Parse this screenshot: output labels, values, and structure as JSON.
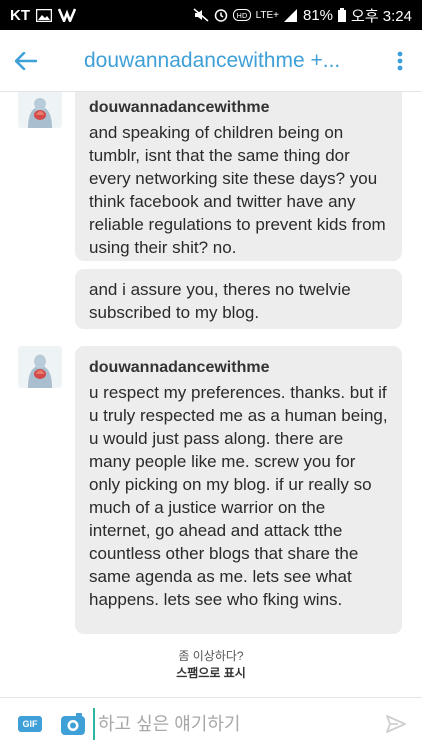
{
  "status_bar": {
    "carrier": "KT",
    "network": "LTE+",
    "battery": "81%",
    "time": "오후 3:24"
  },
  "header": {
    "title": "douwannadancewithme +..."
  },
  "messages": [
    {
      "author": "douwannadancewithme",
      "text": "and speaking of children being on tumblr, isnt that the same thing dor every networking site these days? you think facebook and twitter have any reliable regulations to prevent kids from using their shit? no."
    },
    {
      "text": "and i assure you, theres no twelvie subscribed to my blog."
    },
    {
      "author": "douwannadancewithme",
      "text": "u respect my preferences. thanks. but if u truly respected me as a human being, u would just pass along. there are many people like me. screw you for only picking on my blog. if ur really so much of a justice warrior on the internet, go ahead and attack tthe countless other blogs that share the same agenda as me. lets see what happens. lets see who fking wins."
    }
  ],
  "spam_notice": {
    "question": "좀 이상하다?",
    "action": "스팸으로 표시"
  },
  "compose": {
    "gif_label": "GIF",
    "placeholder": "하고 싶은 얘기하기"
  },
  "colors": {
    "accent": "#3fa0d8",
    "bubble": "#ededed",
    "cursor": "#2cb5a0"
  }
}
